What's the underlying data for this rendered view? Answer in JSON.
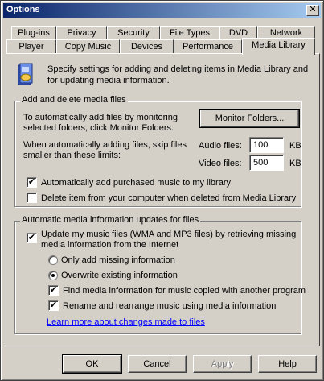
{
  "window": {
    "title": "Options",
    "close_glyph": "✕"
  },
  "tabs_row1": [
    "Plug-ins",
    "Privacy",
    "Security",
    "File Types",
    "DVD",
    "Network"
  ],
  "tabs_row2": [
    "Player",
    "Copy Music",
    "Devices",
    "Performance",
    "Media Library"
  ],
  "active_tab": "Media Library",
  "intro": {
    "icon": "media-library-icon",
    "line1": "Specify settings for adding and deleting items in Media Library and",
    "line2": "for updating media information."
  },
  "add_delete_group": {
    "title": "Add and delete media files",
    "monitor_text_line1": "To automatically add files by monitoring",
    "monitor_text_line2": "selected folders, click Monitor Folders.",
    "monitor_button": "Monitor Folders...",
    "skip_text_line1": "When automatically adding files, skip files",
    "skip_text_line2": "smaller than these limits:",
    "audio_label": "Audio files:",
    "audio_value": "100",
    "audio_unit": "KB",
    "video_label": "Video files:",
    "video_value": "500",
    "video_unit": "KB",
    "auto_add_purchased": {
      "label": "Automatically add purchased music to my library",
      "checked": true
    },
    "delete_from_computer": {
      "label": "Delete item from your computer when deleted from Media Library",
      "checked": false
    }
  },
  "auto_update_group": {
    "title": "Automatic media information updates for files",
    "update_files": {
      "label_line1": "Update my music files (WMA and MP3 files) by retrieving missing",
      "label_line2": "media information from the Internet",
      "checked": true
    },
    "only_add_missing": {
      "label": "Only add missing information",
      "selected": false
    },
    "overwrite_existing": {
      "label": "Overwrite existing information",
      "selected": true
    },
    "find_media_info": {
      "label": "Find media information for music copied with another program",
      "checked": true
    },
    "rename_rearrange": {
      "label": "Rename and rearrange music using media information",
      "checked": true
    },
    "learn_more_link": "Learn more about changes made to files"
  },
  "buttons": {
    "ok": "OK",
    "cancel": "Cancel",
    "apply": "Apply",
    "help": "Help"
  },
  "check_glyph": "✔"
}
